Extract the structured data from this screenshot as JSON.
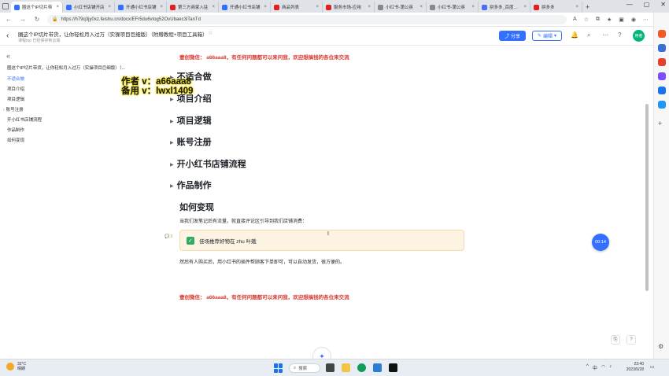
{
  "browser": {
    "tabs": [
      {
        "label": "圈这个IP切片带",
        "color": "#3370ff",
        "active": true
      },
      {
        "label": "小红书店铺开店",
        "color": "#3370ff",
        "active": false
      },
      {
        "label": "开通小红书店铺",
        "color": "#3370ff",
        "active": false
      },
      {
        "label": "第三方商家入驻",
        "color": "#e02020",
        "active": false
      },
      {
        "label": "开通小红书店铺",
        "color": "#3370ff",
        "active": false
      },
      {
        "label": "商品列表",
        "color": "#e02020",
        "active": false
      },
      {
        "label": "服务市场-应用",
        "color": "#e02020",
        "active": false
      },
      {
        "label": "小红书-蒲公英",
        "color": "#888888",
        "active": false
      },
      {
        "label": "小红书-蒲公英",
        "color": "#888888",
        "active": false
      },
      {
        "label": "拼多多_百度搜索",
        "color": "#4e6ef2",
        "active": false
      },
      {
        "label": "拼多多",
        "color": "#e02020",
        "active": false
      }
    ],
    "url": "https://h79q3jy0xz.feishu.cn/docx/EFr5du6vtog52OvUbaec3iTanTd",
    "back_icon": "arrow-left-icon",
    "forward_icon": "arrow-right-icon",
    "reload_icon": "reload-icon"
  },
  "doc": {
    "title": "圈这个IP切片带货，让你轻松月入过万（实操项目巨细版）（附赠教程+项目工具箱）",
    "meta": "课程top    已经保存到云端",
    "share_label": "分享",
    "edit_label": "编辑",
    "avatar_text": "用者"
  },
  "outline": {
    "title": "圈这个IP切片带货，让你轻松月入过万（实操项目巨细版）（...",
    "items": [
      {
        "label": "不适合做",
        "active": true,
        "arrow": false
      },
      {
        "label": "项目介绍",
        "active": false,
        "arrow": false
      },
      {
        "label": "项目逻辑",
        "active": false,
        "arrow": false
      },
      {
        "label": "账号注册",
        "active": false,
        "arrow": true
      },
      {
        "label": "开小红书店铺流程",
        "active": false,
        "arrow": false
      },
      {
        "label": "作品制作",
        "active": false,
        "arrow": false
      },
      {
        "label": "如何变现",
        "active": false,
        "arrow": false
      }
    ]
  },
  "watermark": {
    "line1": "作者 v：a66aaa8",
    "line2": "备用 v：lwxl1409"
  },
  "content": {
    "promo_top": "壹创微信： a66aaa8，有任何问题都可以来问我，欢迎想搞钱的各位来交流",
    "headings": [
      "不适合做",
      "项目介绍",
      "项目逻辑",
      "账号注册",
      "开小红书店铺流程",
      "作品制作"
    ],
    "how_heading": "如何变现",
    "para1": "当我们发笔记后有流量，就直接评论区引导到我们店铺消费：",
    "callout_text": "佳场推荐好物在  zhu  叶娥",
    "para2": "然后有人购买后，用小红书的插件帮顾客下单即可，可以自动发货，很方便的。",
    "promo_bottom": "壹创微信： a66aaa8，有任何问题都可以来问我，欢迎想搞钱的各位来交流",
    "comment_count": "0",
    "timer": "00:14"
  },
  "taskbar": {
    "temp": "32°C",
    "weather": "晴朗",
    "search_label": "搜索",
    "time": "23:40",
    "date": "2023/5/28",
    "lang": "中"
  }
}
